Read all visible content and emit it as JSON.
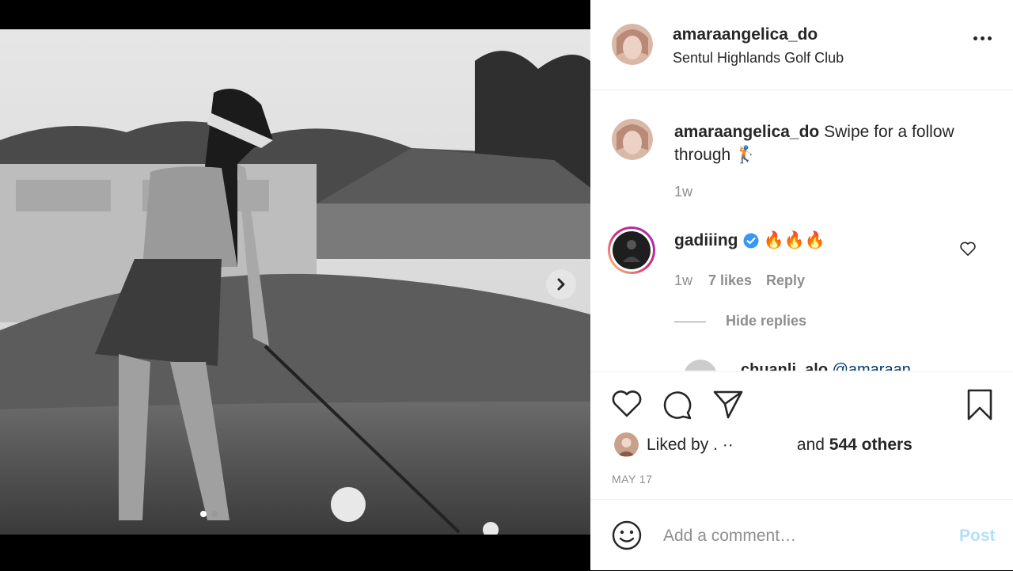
{
  "post": {
    "username": "amaraangelica_do",
    "location": "Sentul Highlands Golf Club",
    "caption": "Swipe for a follow through 🏌",
    "caption_time": "1w",
    "likes_prefix": "Liked by",
    "likes_hidden": ". ··",
    "likes_and": "and",
    "likes_count": "544 others",
    "date": "MAY 17"
  },
  "comments": [
    {
      "username": "gadiiing",
      "text": "🔥🔥🔥",
      "time": "1w",
      "likes": "7 likes",
      "reply": "Reply",
      "verified": true
    }
  ],
  "replies": {
    "toggle_label": "Hide replies",
    "partial_username": "chuanli_alo",
    "partial_text": "@amaraan..."
  },
  "composer": {
    "placeholder": "Add a comment…",
    "post_label": "Post"
  },
  "carousel": {
    "current": 1,
    "total": 2
  },
  "colors": {
    "accent": "#0095f6",
    "post_disabled": "#b2dffc",
    "secondary_text": "#8e8e8e"
  }
}
